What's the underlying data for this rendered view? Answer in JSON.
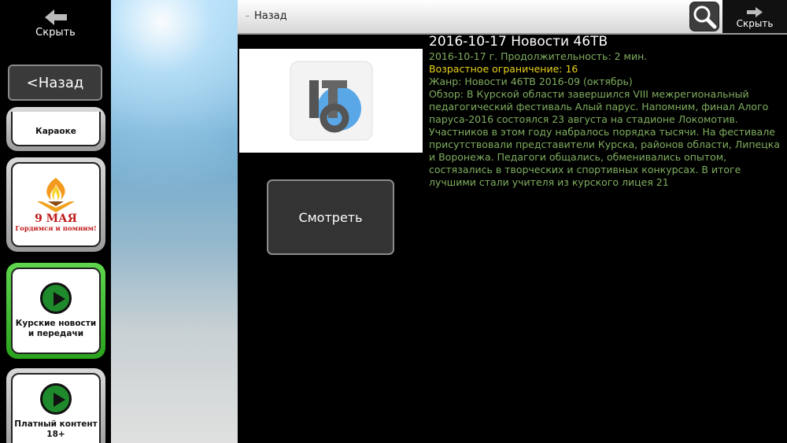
{
  "sidebar": {
    "hide_label": "Скрыть",
    "back_label": "<Назад",
    "tiles": [
      {
        "title": "Караоке"
      },
      {
        "title_line1": "9 МАЯ",
        "title_line2": "Гордимся и помним!"
      },
      {
        "title": "Курские новости и передачи"
      },
      {
        "title": "Платный контент 18+"
      }
    ]
  },
  "topbar": {
    "back_label": "Назад",
    "hide_label": "Скрыть",
    "search_icon": "search-icon"
  },
  "content": {
    "title": "2016-10-17 Новости 46ТВ",
    "meta": "2016-10-17 г. Продолжительность: 2 мин.",
    "age": "Возрастное ограничение: 16",
    "genre": "Жанр: Новости 46ТВ 2016-09 (октябрь)",
    "description": "Обзор: В Курской области завершился VIII межрегиональный педагогический фестиваль Алый парус. Напомним, финал Алого паруса-2016 состоялся 23 августа на стадионе Локомотив. Участников в этом году набралось порядка тысячи. На фестивале присутствовали представители Курска, районов области, Липецка и Воронежа. Педагоги общались, обменивались опытом, состязались в творческих и спортивных конкурсах. В итоге лучшими стали учителя из курского лицея 21",
    "watch_label": "Смотреть",
    "logo_text": "ТВ"
  },
  "colors": {
    "accent_green": "#2aa31c",
    "meta_text": "#7fae5e",
    "age_text": "#e8d21a"
  }
}
